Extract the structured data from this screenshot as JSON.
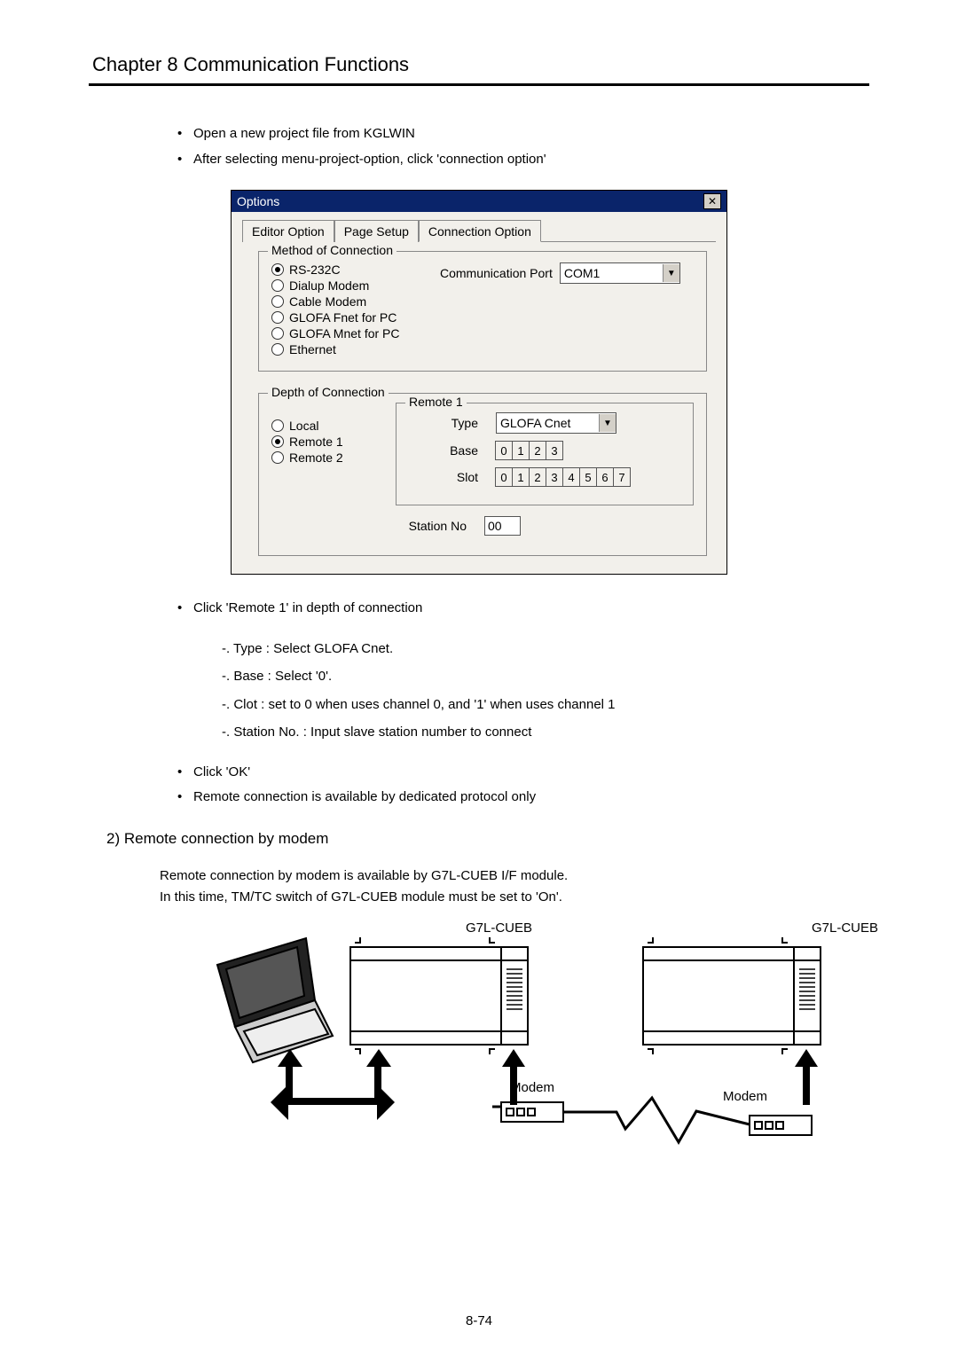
{
  "chapter_title": "Chapter 8    Communication Functions",
  "intro_bullets": [
    "Open a new project file from KGLWIN",
    "After selecting menu-project-option, click 'connection option'"
  ],
  "dialog": {
    "title": "Options",
    "close": "✕",
    "tabs": [
      "Editor Option",
      "Page Setup",
      "Connection Option"
    ],
    "active_tab_index": 2,
    "method_group": {
      "legend": "Method of Connection",
      "radios": [
        "RS-232C",
        "Dialup Modem",
        "Cable Modem",
        "GLOFA Fnet for PC",
        "GLOFA Mnet for PC",
        "Ethernet"
      ],
      "selected_index": 0,
      "comm_port_label": "Communication Port",
      "comm_port_value": "COM1"
    },
    "depth_group": {
      "legend": "Depth of Connection",
      "radios": [
        "Local",
        "Remote 1",
        "Remote 2"
      ],
      "selected_index": 1,
      "remote_box": {
        "legend": "Remote 1",
        "type_label": "Type",
        "type_value": "GLOFA Cnet",
        "base_label": "Base",
        "base_values": [
          "0",
          "1",
          "2",
          "3"
        ],
        "slot_label": "Slot",
        "slot_values": [
          "0",
          "1",
          "2",
          "3",
          "4",
          "5",
          "6",
          "7"
        ],
        "station_label": "Station No",
        "station_value": "00"
      }
    }
  },
  "post_bullets_1": [
    "Click 'Remote 1' in depth of connection"
  ],
  "sub_items": [
    "-. Type : Select GLOFA Cnet.",
    "-. Base : Select '0'.",
    "-. Clot : set to 0 when uses channel 0, and '1' when uses channel 1",
    "-. Station No. : Input slave station number to connect"
  ],
  "post_bullets_2": [
    "Click 'OK'",
    "Remote connection is available by dedicated protocol only"
  ],
  "section2_title": "2)   Remote connection by modem",
  "modem_para_1": "Remote connection by modem is available by G7L-CUEB I/F module.",
  "modem_para_2": "In this time, TM/TC switch of G7L-CUEB module must be set to 'On'.",
  "diagram_labels": {
    "left_unit": "G7L-CUEB",
    "right_unit": "G7L-CUEB",
    "modem_left": "Modem",
    "modem_right": "Modem"
  },
  "page_number": "8-74"
}
